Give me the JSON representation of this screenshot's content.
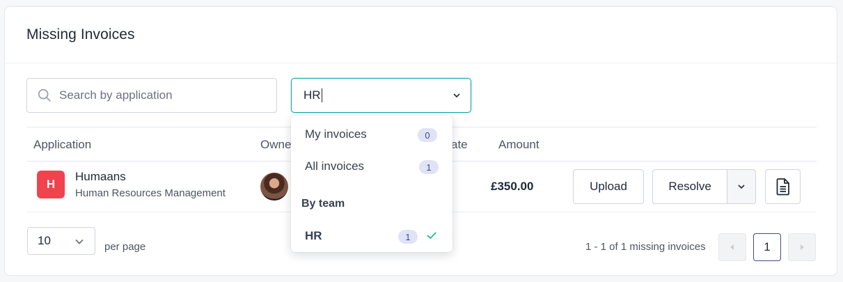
{
  "card": {
    "title": "Missing Invoices"
  },
  "search": {
    "placeholder": "Search by application"
  },
  "team_select": {
    "value": "HR"
  },
  "table": {
    "headers": {
      "application": "Application",
      "owner": "Owne",
      "date": "ate",
      "amount": "Amount"
    },
    "rows": [
      {
        "logo_letter": "H",
        "app_name": "Humaans",
        "app_category": "Human Resources Management",
        "amount": "£350.00",
        "upload_label": "Upload",
        "resolve_label": "Resolve"
      }
    ]
  },
  "dropdown": {
    "items": [
      {
        "label": "My invoices",
        "count": "0"
      },
      {
        "label": "All invoices",
        "count": "1"
      }
    ],
    "group_label": "By team",
    "team_items": [
      {
        "label": "HR",
        "count": "1",
        "selected": true
      }
    ]
  },
  "pagination": {
    "per_page_value": "10",
    "per_page_label": "per page",
    "range_text": "1 - 1 of 1 missing invoices",
    "current_page": "1"
  },
  "colors": {
    "accent": "#14a3a8",
    "logo_bg": "#f0434e",
    "badge_bg": "#e0e3f6",
    "badge_text": "#3b4a8c",
    "check": "#2fbf8f",
    "current_page_border": "#3b4a8c"
  },
  "icons": {
    "search": "search-icon",
    "chevron": "chevron-down-icon",
    "document": "document-icon",
    "check": "check-icon",
    "prev": "triangle-left-icon",
    "next": "triangle-right-icon"
  }
}
